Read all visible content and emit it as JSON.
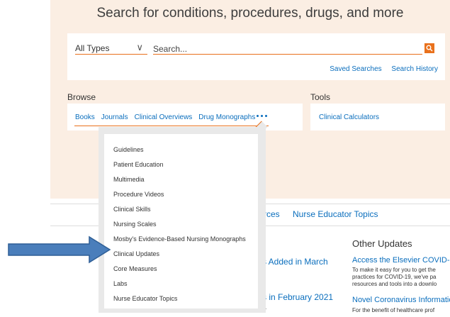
{
  "hero": {
    "title": "Search for conditions, procedures, drugs, and more"
  },
  "search": {
    "type_value": "All Types",
    "placeholder": "Search...",
    "saved_searches": "Saved Searches",
    "search_history": "Search History"
  },
  "browse": {
    "label": "Browse",
    "links": [
      "Books",
      "Journals",
      "Clinical Overviews",
      "Drug Monographs"
    ]
  },
  "tools": {
    "label": "Tools",
    "links": [
      "Clinical Calculators"
    ]
  },
  "dropdown": {
    "items": [
      "Guidelines",
      "Patient Education",
      "Multimedia",
      "Procedure Videos",
      "Clinical Skills",
      "Nursing Scales",
      "Mosby's Evidence-Based Nursing Monographs",
      "Clinical Updates",
      "Core Measures",
      "Labs",
      "Nurse Educator Topics"
    ]
  },
  "nav": {
    "partial_tab": "rces",
    "nurse_educator": "Nurse Educator Topics"
  },
  "news": {
    "item1": "s Added in March",
    "item2": "s in February 2021",
    "item2_sub": "y."
  },
  "other_updates": {
    "title": "Other Updates",
    "items": [
      {
        "title": "Access the Elsevier COVID-1",
        "lines": [
          "To make it easy for you to get the",
          "practices for COVID-19, we've pa",
          "resources and tools into a downlo"
        ]
      },
      {
        "title": "Novel Coronavirus Informatic",
        "lines": [
          "For the benefit of healthcare prof"
        ]
      }
    ]
  },
  "colors": {
    "accent": "#e9711c",
    "link": "#0a6ebd",
    "hero_bg": "#fbeee3",
    "arrow": "#4a7ebb"
  }
}
